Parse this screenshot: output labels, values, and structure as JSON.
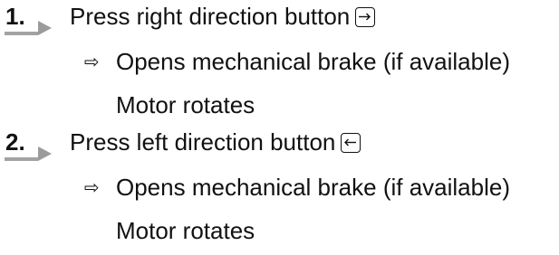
{
  "steps": [
    {
      "number": "1.",
      "text": "Press right direction button",
      "key_icon": "right-arrow-key-icon",
      "result": "Opens mechanical brake (if available)",
      "result_symbol": "⇨",
      "note": "Motor rotates"
    },
    {
      "number": "2.",
      "text": "Press left direction button",
      "key_icon": "left-arrow-key-icon",
      "result": "Opens mechanical brake (if available)",
      "result_symbol": "⇨",
      "note": "Motor rotates"
    }
  ],
  "colors": {
    "text": "#111111",
    "step_marker": "#9b9b9b",
    "underline": "#a3a3a3"
  }
}
